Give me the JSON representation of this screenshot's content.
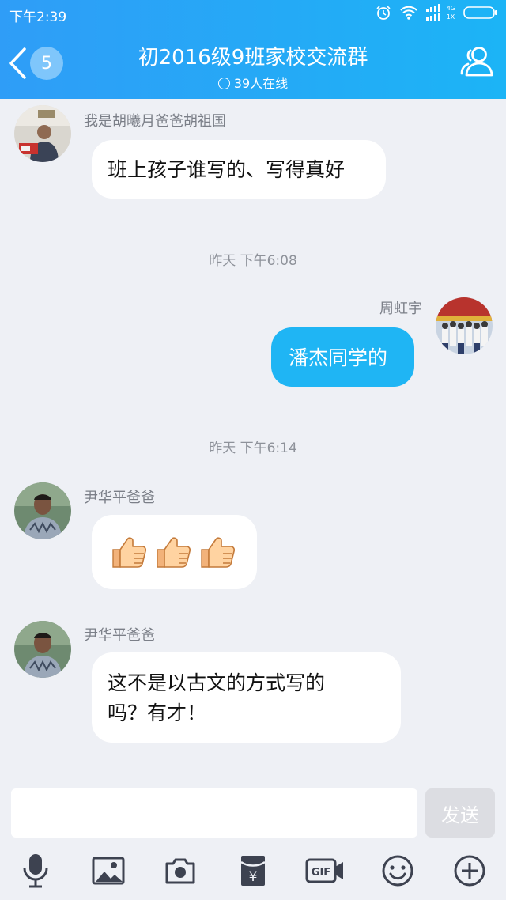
{
  "status_bar": {
    "time": "下午2:39",
    "network_top": "4G",
    "network_bottom": "1X"
  },
  "header": {
    "title": "初2016级9班家校交流群",
    "online": "39人在线",
    "unread_count": "5"
  },
  "messages": [
    {
      "sender": "我是胡曦月爸爸胡祖国",
      "text": "班上孩子谁写的、写得真好"
    },
    {
      "timestamp": "昨天 下午6:08"
    },
    {
      "sender": "周虹宇",
      "text": "潘杰同学的"
    },
    {
      "timestamp": "昨天 下午6:14"
    },
    {
      "sender": "尹华平爸爸",
      "emoji": [
        "thumbs-up",
        "thumbs-up",
        "thumbs-up"
      ]
    },
    {
      "sender": "尹华平爸爸",
      "text_line1": "这不是以古文的方式写的",
      "text_line2": "吗？有才！"
    }
  ],
  "input": {
    "value": "",
    "send_label": "发送"
  },
  "toolbar_icons": [
    "microphone-icon",
    "image-icon",
    "camera-icon",
    "red-packet-icon",
    "gif-icon",
    "emoji-icon",
    "plus-icon"
  ],
  "colors": {
    "header_start": "#2f9df7",
    "header_end": "#1cb4f6",
    "self_bubble": "#1fb5f4",
    "background": "#eef0f5"
  }
}
